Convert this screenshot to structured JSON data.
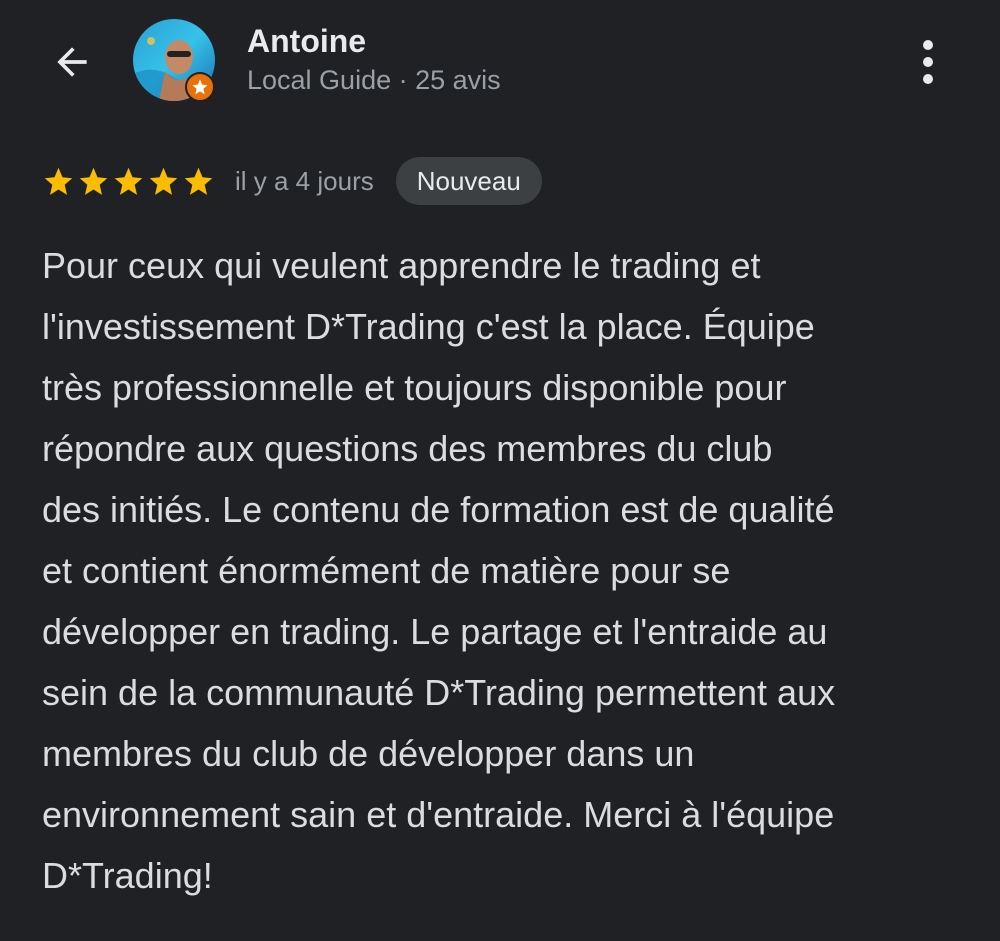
{
  "header": {
    "back_icon": "arrow-left-icon",
    "author_name": "Antoine",
    "author_meta": "Local Guide · 25 avis",
    "avatar": "profile-photo",
    "badge_icon": "local-guide-star-icon",
    "more_icon": "more-vertical-icon"
  },
  "review": {
    "rating": 5,
    "rating_max": 5,
    "star_color": "#fbbc04",
    "date": "il y a 4 jours",
    "new_badge": "Nouveau",
    "lines": [
      "Pour ceux qui veulent apprendre le trading et",
      "l'investissement D*Trading c'est la place. Équipe",
      "très professionnelle et toujours disponible pour",
      "répondre aux questions des membres du club",
      "des initiés. Le contenu de formation est de qualité",
      "et contient énormément de matière pour se",
      "développer en trading. Le partage et l'entraide au",
      "sein de la communauté D*Trading permettent aux",
      "membres du club de développer dans un",
      "environnement sain et d'entraide. Merci à l'équipe",
      "D*Trading!"
    ]
  },
  "colors": {
    "background": "#202124",
    "primary_text": "#e8eaed",
    "secondary_text": "#9aa0a6",
    "badge_bg": "#3c4043",
    "guide_badge": "#e8710a"
  }
}
